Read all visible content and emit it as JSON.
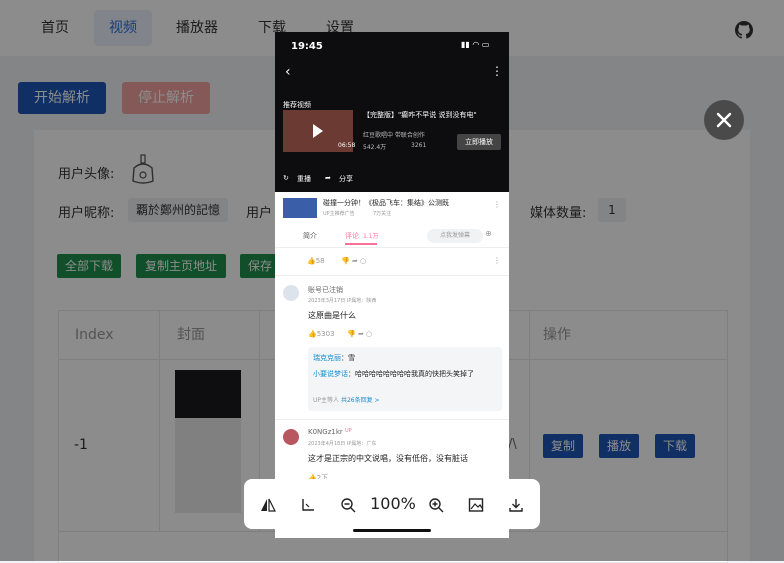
{
  "nav": {
    "items": [
      "首页",
      "视频",
      "播放器",
      "下载",
      "设置"
    ],
    "active": "视频"
  },
  "toolbar": {
    "start": "开始解析",
    "stop": "停止解析"
  },
  "profile": {
    "avatar_label": "用户头像:",
    "nickname_label": "用户昵称:",
    "nickname_value": "覇於鄭州的記憶",
    "user_label_partial": "用户",
    "media_count_label": "媒体数量:",
    "media_count_value": "1"
  },
  "actions": {
    "download_all": "全部下载",
    "copy_home": "复制主页地址",
    "save_partial": "保存"
  },
  "table": {
    "headers": {
      "index": "Index",
      "cover": "封面",
      "ops": "操作"
    },
    "row": {
      "index": "-1",
      "copy": "复制",
      "play": "播放",
      "download": "下载",
      "partial_text": "/\\"
    }
  },
  "phone": {
    "time": "19:45",
    "recommend": "推荐视频",
    "video_title": "【完整版】\"癫咋不早说 说到没有电\"",
    "uploader": "红豆歌唱中 带联合创作",
    "views": "542.4万",
    "danmaku": "3261",
    "duration": "06:58",
    "play_now": "立即播放",
    "replay": "重播",
    "share": "分享",
    "ad_text": "碰撞一分钟！《极品飞车：集结》公测既",
    "ad_sub": "7万关注",
    "ad_tag": "UP主推荐广告",
    "tab_intro": "简介",
    "tab_comments": "评论",
    "comment_count": "1.1万",
    "danmaku_btn": "点我发弹幕",
    "like_top": "58",
    "c1": {
      "user": "账号已注销",
      "date": "2023年3月17日 IP属地：陕西",
      "text": "这原曲是什么",
      "likes": "5303"
    },
    "reply1_user": "瑞克克丽",
    "reply1_text": "：雪",
    "reply2_user": "小要说梦话",
    "reply2_text": "：哈哈哈哈哈哈哈哈我真的快把头笑掉了",
    "reply_more_pre": "UP主等人",
    "reply_more_link": "共26条回复 >",
    "c2": {
      "user": "K0NGz1kr",
      "badge": "UP",
      "date": "2023年4月18日 IP属地：广东",
      "text": "这才是正宗的中文说唱，没有低俗，没有脏话",
      "likes": "2下"
    }
  },
  "viewer": {
    "zoom": "100%"
  },
  "colors": {
    "primary": "#1c57b8",
    "success": "#1f8f4e",
    "danger_light": "#f5a3a3",
    "pink": "#fb7299"
  },
  "icons": [
    "github-icon",
    "close-icon",
    "flip-icon",
    "rotate-icon",
    "zoom-out-icon",
    "zoom-in-icon",
    "image-icon",
    "download-icon"
  ]
}
